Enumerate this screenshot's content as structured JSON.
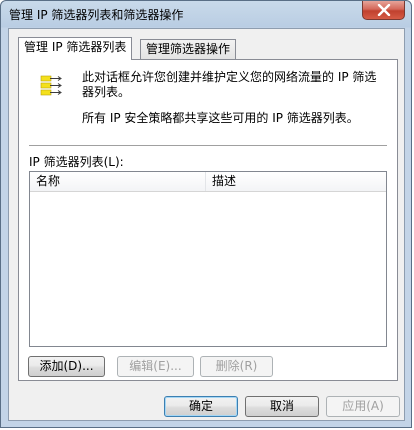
{
  "window": {
    "title": "管理 IP 筛选器列表和筛选器操作"
  },
  "tabs": [
    {
      "label": "管理 IP 筛选器列表",
      "active": true
    },
    {
      "label": "管理筛选器操作",
      "active": false
    }
  ],
  "panel": {
    "icon": "filter-list-icon",
    "description_1": "此对话框允许您创建并维护定义您的网络流量的 IP 筛选器列表。",
    "description_2": "所有 IP 安全策略都共享这些可用的 IP 筛选器列表。",
    "list_label": "IP 筛选器列表(L):",
    "columns": [
      "名称",
      "描述"
    ],
    "rows": []
  },
  "buttons": {
    "add": "添加(D)...",
    "edit": "编辑(E)...",
    "delete": "删除(R)",
    "ok": "确定",
    "cancel": "取消",
    "apply": "应用(A)"
  },
  "colors": {
    "title_bar": "#b9cde3",
    "close_button": "#c0412f",
    "icon_yellow": "#f4e01c"
  }
}
